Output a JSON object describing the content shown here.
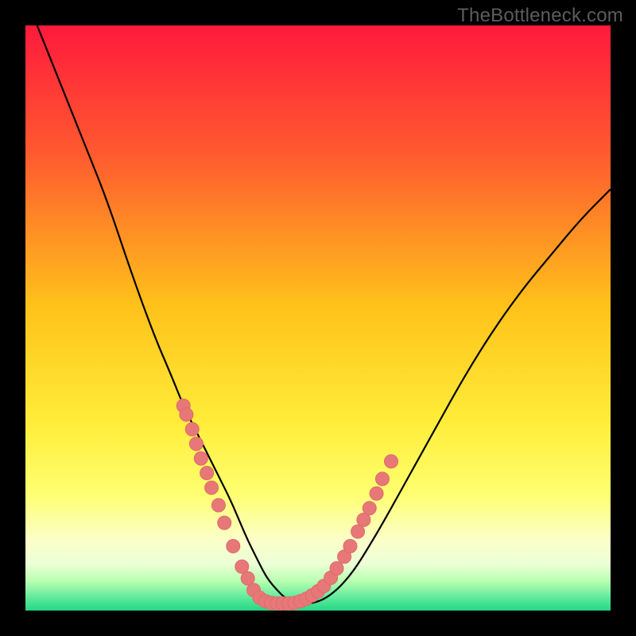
{
  "watermark": "TheBottleneck.com",
  "colors": {
    "background": "#000000",
    "grad_top": "#ff1a3c",
    "grad_mid1": "#ff6a2a",
    "grad_mid2": "#ffd21a",
    "grad_mid3": "#ffff66",
    "grad_bottom_light": "#f8ffe0",
    "grad_green1": "#a8ff8a",
    "grad_green2": "#2be07c",
    "curve": "#000000",
    "dot_fill": "#e87878",
    "dot_stroke": "#dd6b6b"
  },
  "chart_data": {
    "type": "line",
    "title": "",
    "xlabel": "",
    "ylabel": "",
    "xlim": [
      0,
      100
    ],
    "ylim": [
      0,
      100
    ],
    "series": [
      {
        "name": "bottleneck-curve",
        "x": [
          2,
          6,
          10,
          14,
          18,
          22,
          25,
          27,
          29,
          31,
          33,
          35,
          36.5,
          38,
          39.5,
          41,
          42.5,
          45,
          50,
          55,
          60,
          65,
          70,
          75,
          80,
          85,
          90,
          95,
          100
        ],
        "y": [
          100,
          90,
          80,
          70,
          58,
          47,
          40,
          35,
          31,
          27,
          23,
          19,
          15.5,
          12,
          9,
          6,
          4,
          1.5,
          1,
          5,
          13,
          22,
          31,
          40,
          48,
          55,
          61,
          67,
          72
        ]
      }
    ],
    "scatter_points": {
      "name": "markers",
      "points": [
        {
          "x": 27,
          "y": 35
        },
        {
          "x": 27.5,
          "y": 33.5
        },
        {
          "x": 28.5,
          "y": 31
        },
        {
          "x": 29.2,
          "y": 28.5
        },
        {
          "x": 30,
          "y": 26
        },
        {
          "x": 31,
          "y": 23.5
        },
        {
          "x": 31.8,
          "y": 21
        },
        {
          "x": 33,
          "y": 18
        },
        {
          "x": 34,
          "y": 15
        },
        {
          "x": 35.5,
          "y": 11
        },
        {
          "x": 37,
          "y": 7.5
        },
        {
          "x": 38,
          "y": 5.5
        },
        {
          "x": 39,
          "y": 3.5
        },
        {
          "x": 40,
          "y": 2.2
        },
        {
          "x": 41,
          "y": 1.6
        },
        {
          "x": 42,
          "y": 1.3
        },
        {
          "x": 43,
          "y": 1.2
        },
        {
          "x": 44,
          "y": 1.2
        },
        {
          "x": 45,
          "y": 1.2
        },
        {
          "x": 46,
          "y": 1.3
        },
        {
          "x": 47,
          "y": 1.6
        },
        {
          "x": 48,
          "y": 2.0
        },
        {
          "x": 49,
          "y": 2.6
        },
        {
          "x": 50,
          "y": 3.3
        },
        {
          "x": 51,
          "y": 4.2
        },
        {
          "x": 52.2,
          "y": 5.6
        },
        {
          "x": 53.2,
          "y": 7.2
        },
        {
          "x": 54.5,
          "y": 9.2
        },
        {
          "x": 55.5,
          "y": 11
        },
        {
          "x": 56.8,
          "y": 13.5
        },
        {
          "x": 57.8,
          "y": 15.5
        },
        {
          "x": 58.8,
          "y": 17.5
        },
        {
          "x": 60,
          "y": 20
        },
        {
          "x": 61,
          "y": 22.5
        },
        {
          "x": 62.5,
          "y": 25.5
        }
      ]
    }
  }
}
